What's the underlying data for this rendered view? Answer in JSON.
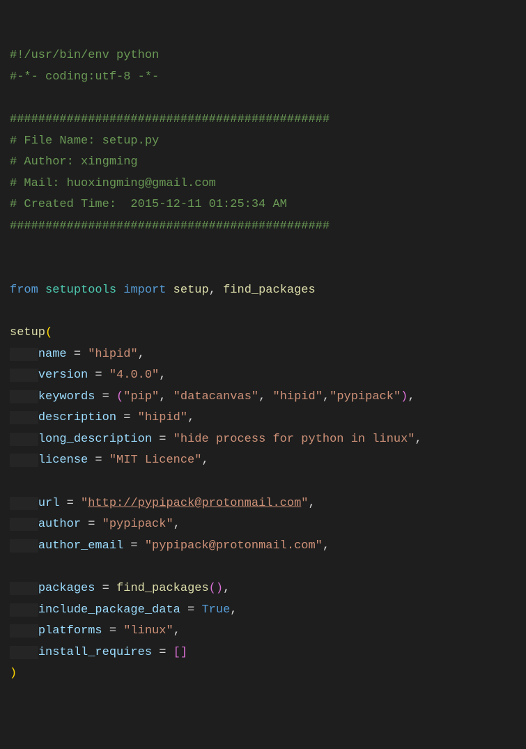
{
  "shebang": "#!/usr/bin/env python",
  "coding": "#-*- coding:utf-8 -*-",
  "divider": "#############################################",
  "hdr_filename": "# File Name: setup.py",
  "hdr_author": "# Author: xingming",
  "hdr_mail": "# Mail: huoxingming@gmail.com",
  "hdr_created": "# Created Time:  2015-12-11 01:25:34 AM",
  "kw_from": "from",
  "mod_setuptools": "setuptools",
  "kw_import": "import",
  "fn_setup": "setup",
  "fn_findpkg": "find_packages",
  "arg": {
    "name": "name",
    "version": "version",
    "keywords": "keywords",
    "description": "description",
    "long_description": "long_description",
    "license": "license",
    "url": "url",
    "author": "author",
    "author_email": "author_email",
    "packages": "packages",
    "include_package_data": "include_package_data",
    "platforms": "platforms",
    "install_requires": "install_requires"
  },
  "val": {
    "name": "\"hipid\"",
    "version": "\"4.0.0\"",
    "kw1": "\"pip\"",
    "kw2": "\"datacanvas\"",
    "kw3": "\"hipid\"",
    "kw4": "\"pypipack\"",
    "description": "\"hipid\"",
    "long_description": "\"hide process for python in linux\"",
    "license": "\"MIT Licence\"",
    "url_q1": "\"",
    "url_link": "http://pypipack@protonmail.com",
    "url_q2": "\"",
    "author": "\"pypipack\"",
    "author_email": "\"pypipack@protonmail.com\"",
    "true": "True",
    "platforms": "\"linux\""
  },
  "eq": " = ",
  "comma": ", ",
  "commaend": ",",
  "lparen": "(",
  "rparen": ")",
  "lparen2": "(",
  "rparen2": ")",
  "lbr": "[",
  "rbr": "]"
}
